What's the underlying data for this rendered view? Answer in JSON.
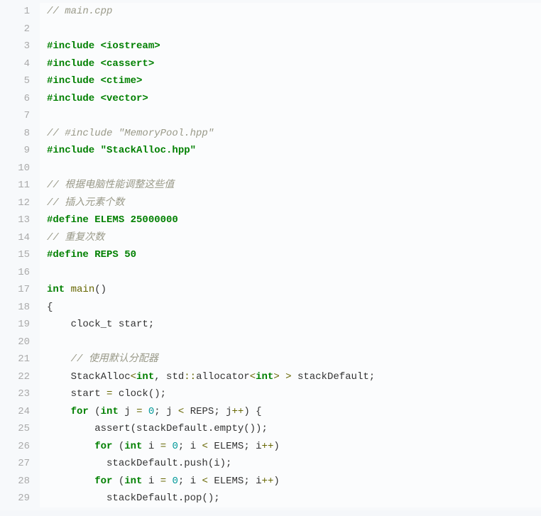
{
  "lines": [
    {
      "n": 1,
      "t": [
        {
          "c": "c",
          "v": "// main.cpp"
        }
      ]
    },
    {
      "n": 2,
      "t": []
    },
    {
      "n": 3,
      "t": [
        {
          "c": "cp",
          "v": "#include <iostream>"
        }
      ]
    },
    {
      "n": 4,
      "t": [
        {
          "c": "cp",
          "v": "#include <cassert>"
        }
      ]
    },
    {
      "n": 5,
      "t": [
        {
          "c": "cp",
          "v": "#include <ctime>"
        }
      ]
    },
    {
      "n": 6,
      "t": [
        {
          "c": "cp",
          "v": "#include <vector>"
        }
      ]
    },
    {
      "n": 7,
      "t": []
    },
    {
      "n": 8,
      "t": [
        {
          "c": "c",
          "v": "// #include \"MemoryPool.hpp\""
        }
      ]
    },
    {
      "n": 9,
      "t": [
        {
          "c": "cp",
          "v": "#include \"StackAlloc.hpp\""
        }
      ]
    },
    {
      "n": 10,
      "t": []
    },
    {
      "n": 11,
      "t": [
        {
          "c": "c",
          "v": "// 根据电脑性能调整这些值"
        }
      ]
    },
    {
      "n": 12,
      "t": [
        {
          "c": "c",
          "v": "// 插入元素个数"
        }
      ]
    },
    {
      "n": 13,
      "t": [
        {
          "c": "cp",
          "v": "#define ELEMS 25000000"
        }
      ]
    },
    {
      "n": 14,
      "t": [
        {
          "c": "c",
          "v": "// 重复次数"
        }
      ]
    },
    {
      "n": 15,
      "t": [
        {
          "c": "cp",
          "v": "#define REPS 50"
        }
      ]
    },
    {
      "n": 16,
      "t": []
    },
    {
      "n": 17,
      "t": [
        {
          "c": "kw",
          "v": "int"
        },
        {
          "c": "pl",
          "v": " "
        },
        {
          "c": "fn",
          "v": "main"
        },
        {
          "c": "pl",
          "v": "()"
        }
      ]
    },
    {
      "n": 18,
      "t": [
        {
          "c": "pl",
          "v": "{"
        }
      ]
    },
    {
      "n": 19,
      "t": [
        {
          "c": "pl",
          "v": "    clock_t start;"
        }
      ]
    },
    {
      "n": 20,
      "t": []
    },
    {
      "n": 21,
      "t": [
        {
          "c": "pl",
          "v": "    "
        },
        {
          "c": "c",
          "v": "// 使用默认分配器"
        }
      ]
    },
    {
      "n": 22,
      "t": [
        {
          "c": "pl",
          "v": "    StackAlloc"
        },
        {
          "c": "op",
          "v": "<"
        },
        {
          "c": "kw",
          "v": "int"
        },
        {
          "c": "pl",
          "v": ", std"
        },
        {
          "c": "op",
          "v": "::"
        },
        {
          "c": "pl",
          "v": "allocator"
        },
        {
          "c": "op",
          "v": "<"
        },
        {
          "c": "kw",
          "v": "int"
        },
        {
          "c": "op",
          "v": ">"
        },
        {
          "c": "pl",
          "v": " "
        },
        {
          "c": "op",
          "v": ">"
        },
        {
          "c": "pl",
          "v": " stackDefault;"
        }
      ]
    },
    {
      "n": 23,
      "t": [
        {
          "c": "pl",
          "v": "    start "
        },
        {
          "c": "op",
          "v": "="
        },
        {
          "c": "pl",
          "v": " clock();"
        }
      ]
    },
    {
      "n": 24,
      "t": [
        {
          "c": "pl",
          "v": "    "
        },
        {
          "c": "kw",
          "v": "for"
        },
        {
          "c": "pl",
          "v": " ("
        },
        {
          "c": "kw",
          "v": "int"
        },
        {
          "c": "pl",
          "v": " j "
        },
        {
          "c": "op",
          "v": "="
        },
        {
          "c": "pl",
          "v": " "
        },
        {
          "c": "num",
          "v": "0"
        },
        {
          "c": "pl",
          "v": "; j "
        },
        {
          "c": "op",
          "v": "<"
        },
        {
          "c": "pl",
          "v": " REPS; j"
        },
        {
          "c": "op",
          "v": "++"
        },
        {
          "c": "pl",
          "v": ") {"
        }
      ]
    },
    {
      "n": 25,
      "t": [
        {
          "c": "pl",
          "v": "        assert(stackDefault.empty());"
        }
      ]
    },
    {
      "n": 26,
      "t": [
        {
          "c": "pl",
          "v": "        "
        },
        {
          "c": "kw",
          "v": "for"
        },
        {
          "c": "pl",
          "v": " ("
        },
        {
          "c": "kw",
          "v": "int"
        },
        {
          "c": "pl",
          "v": " i "
        },
        {
          "c": "op",
          "v": "="
        },
        {
          "c": "pl",
          "v": " "
        },
        {
          "c": "num",
          "v": "0"
        },
        {
          "c": "pl",
          "v": "; i "
        },
        {
          "c": "op",
          "v": "<"
        },
        {
          "c": "pl",
          "v": " ELEMS; i"
        },
        {
          "c": "op",
          "v": "++"
        },
        {
          "c": "pl",
          "v": ")"
        }
      ]
    },
    {
      "n": 27,
      "t": [
        {
          "c": "pl",
          "v": "          stackDefault.push(i);"
        }
      ]
    },
    {
      "n": 28,
      "t": [
        {
          "c": "pl",
          "v": "        "
        },
        {
          "c": "kw",
          "v": "for"
        },
        {
          "c": "pl",
          "v": " ("
        },
        {
          "c": "kw",
          "v": "int"
        },
        {
          "c": "pl",
          "v": " i "
        },
        {
          "c": "op",
          "v": "="
        },
        {
          "c": "pl",
          "v": " "
        },
        {
          "c": "num",
          "v": "0"
        },
        {
          "c": "pl",
          "v": "; i "
        },
        {
          "c": "op",
          "v": "<"
        },
        {
          "c": "pl",
          "v": " ELEMS; i"
        },
        {
          "c": "op",
          "v": "++"
        },
        {
          "c": "pl",
          "v": ")"
        }
      ]
    },
    {
      "n": 29,
      "t": [
        {
          "c": "pl",
          "v": "          stackDefault.pop();"
        }
      ]
    }
  ]
}
